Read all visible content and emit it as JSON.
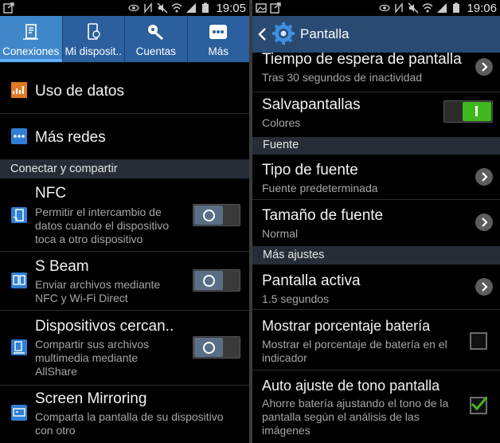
{
  "left": {
    "status": {
      "time": "19:05"
    },
    "tabs": [
      {
        "label": "Conexiones",
        "icon": "connections-icon",
        "active": true
      },
      {
        "label": "Mi disposit..",
        "icon": "my-device-icon",
        "active": false
      },
      {
        "label": "Cuentas",
        "icon": "accounts-key-icon",
        "active": false
      },
      {
        "label": "Más",
        "icon": "more-dots-icon",
        "active": false
      }
    ],
    "items": {
      "data_usage": {
        "title": "Uso de datos",
        "icon": "data-usage-icon"
      },
      "more_networks": {
        "title": "Más redes",
        "icon": "more-networks-icon"
      }
    },
    "section_connect": "Conectar y compartir",
    "share_items": [
      {
        "title": "NFC",
        "subtitle": "Permitir el intercambio de datos cuando el dispositivo toca a otro dispositivo",
        "icon": "nfc-icon",
        "toggle": false
      },
      {
        "title": "S Beam",
        "subtitle": "Enviar archivos mediante NFC y Wi-Fi Direct",
        "icon": "s-beam-icon",
        "toggle": false
      },
      {
        "title": "Dispositivos cercan..",
        "subtitle": "Compartir sus archivos multimedia mediante AllShare",
        "icon": "nearby-devices-icon",
        "toggle": false
      },
      {
        "title": "Screen Mirroring",
        "subtitle": "Comparta la pantalla de su dispositivo con otro",
        "icon": "screen-mirroring-icon"
      }
    ]
  },
  "right": {
    "status": {
      "time": "19:06"
    },
    "header": {
      "title": "Pantalla",
      "icon": "settings-gear-icon"
    },
    "items": {
      "timeout": {
        "title": "Tiempo de espera de pantalla",
        "subtitle": "Tras 30 segundos de inactividad"
      },
      "screensaver": {
        "title": "Salvapantallas",
        "subtitle": "Colores",
        "toggle": true
      }
    },
    "section_font": "Fuente",
    "font_items": {
      "font_type": {
        "title": "Tipo de fuente",
        "subtitle": "Fuente predeterminada"
      },
      "font_size": {
        "title": "Tamaño de fuente",
        "subtitle": "Normal"
      }
    },
    "section_more": "Más ajustes",
    "more_items": {
      "smart_stay": {
        "title": "Pantalla activa",
        "subtitle": "1.5 segundos"
      },
      "battery_pct": {
        "title": "Mostrar porcentaje batería",
        "subtitle": "Mostrar el porcentaje de batería en el indicador",
        "checked": false
      },
      "auto_tone": {
        "title": "Auto ajuste de tono pantalla",
        "subtitle": "Ahorre batería ajustando el tono de la pantalla según el análisis de las imágenes",
        "checked": true
      }
    }
  },
  "colors": {
    "tab_bar": "#2b5f9e",
    "tab_active": "#3f87c9",
    "header": "#2b4a72",
    "section": "#262d36",
    "toggle_on": "#3fb820"
  }
}
